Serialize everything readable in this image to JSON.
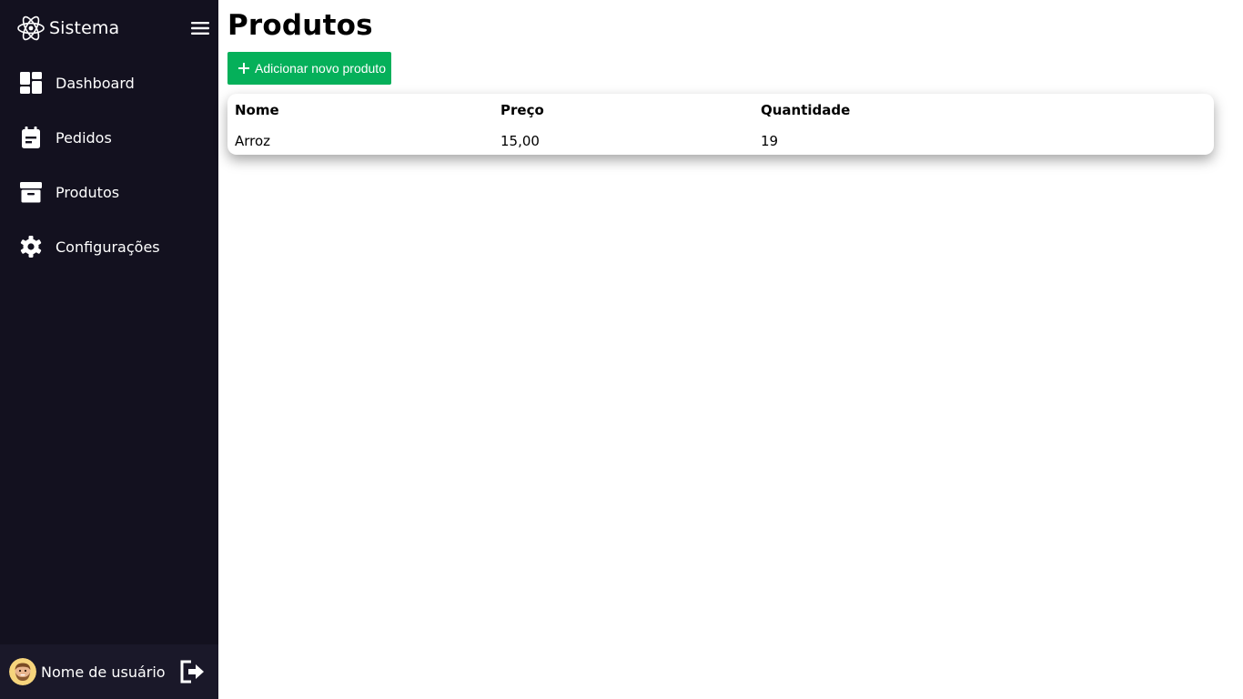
{
  "sidebar": {
    "brand": {
      "icon": "atom-icon",
      "title": "Sistema"
    },
    "menu_toggle_icon": "hamburger-menu-icon",
    "items": [
      {
        "label": "Dashboard",
        "icon": "dashboard-icon"
      },
      {
        "label": "Pedidos",
        "icon": "calendar-icon"
      },
      {
        "label": "Produtos",
        "icon": "archive-icon"
      },
      {
        "label": "Configurações",
        "icon": "gear-icon"
      }
    ],
    "footer": {
      "username": "Nome de usuário",
      "avatar_icon": "user-avatar",
      "logout_icon": "logout-icon"
    }
  },
  "main": {
    "title": "Produtos",
    "add_button": {
      "label": "Adicionar novo produto",
      "icon": "plus-icon"
    },
    "table": {
      "columns": [
        "Nome",
        "Preço",
        "Quantidade"
      ],
      "rows": [
        [
          "Arroz",
          "15,00",
          "19"
        ]
      ]
    }
  },
  "colors": {
    "sidebar_bg": "#13111f",
    "footer_bg": "#1a1829",
    "accent_green": "#05b05a",
    "text_white": "#ffffff"
  }
}
